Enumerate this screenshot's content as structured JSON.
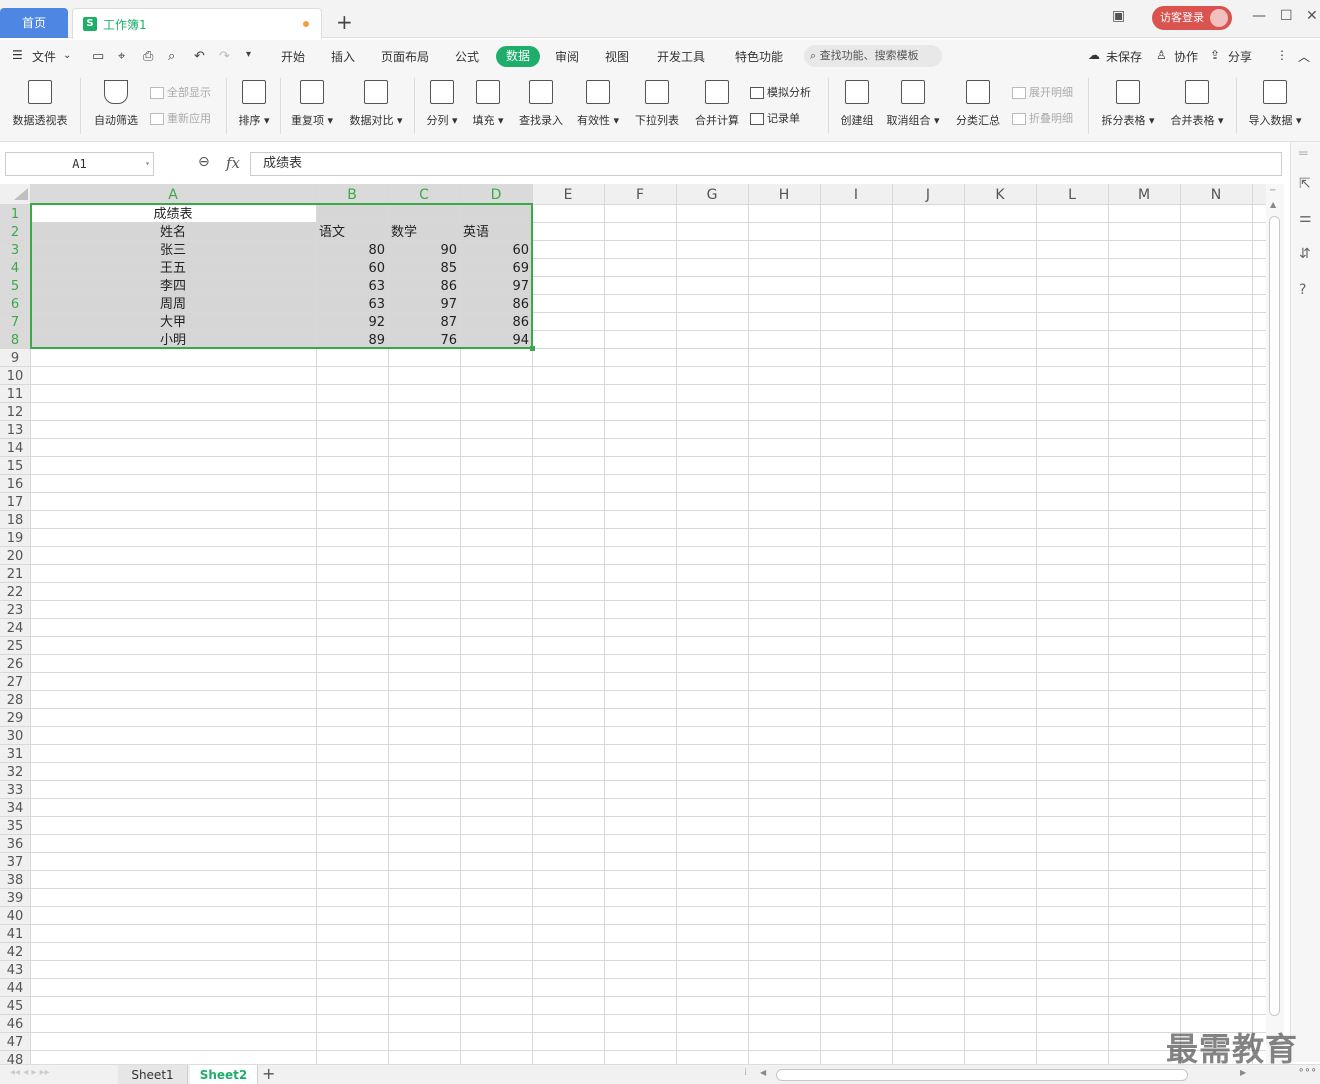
{
  "titlebar": {
    "home_tab": "首页",
    "doc_tab": "工作簿1",
    "sheet_icon_letter": "S",
    "add_tab": "+",
    "login": "访客登录"
  },
  "menubar": {
    "file": "文件",
    "tabs": [
      "开始",
      "插入",
      "页面布局",
      "公式",
      "数据",
      "审阅",
      "视图",
      "开发工具",
      "特色功能"
    ],
    "active_tab": "数据",
    "search": "查找功能、搜索模板",
    "unsaved": "未保存",
    "collab": "协作",
    "share": "分享"
  },
  "ribbon": {
    "pivot": "数据透视表",
    "autofilter": "自动筛选",
    "show_all": "全部显示",
    "reapply": "重新应用",
    "sort": "排序",
    "duplicates": "重复项",
    "compare": "数据对比",
    "split_col": "分列",
    "fill": "填充",
    "lookup": "查找录入",
    "validity": "有效性",
    "dropdown": "下拉列表",
    "consolidate": "合并计算",
    "whatif": "模拟分析",
    "record": "记录单",
    "group": "创建组",
    "ungroup": "取消组合",
    "subtotal": "分类汇总",
    "expand": "展开明细",
    "collapse": "折叠明细",
    "split_table": "拆分表格",
    "merge_table": "合并表格",
    "import": "导入数据"
  },
  "formula": {
    "cell_ref": "A1",
    "fx": "fx",
    "content": "成绩表"
  },
  "sheet": {
    "columns": [
      "A",
      "B",
      "C",
      "D",
      "E",
      "F",
      "G",
      "H",
      "I",
      "J",
      "K",
      "L",
      "M",
      "N"
    ],
    "row_count": 48,
    "title": "成绩表",
    "headers": [
      "姓名",
      "语文",
      "数学",
      "英语"
    ],
    "rows": [
      [
        "张三",
        "80",
        "90",
        "60"
      ],
      [
        "王五",
        "60",
        "85",
        "69"
      ],
      [
        "李四",
        "63",
        "86",
        "97"
      ],
      [
        "周周",
        "63",
        "97",
        "86"
      ],
      [
        "大甲",
        "92",
        "87",
        "86"
      ],
      [
        "小明",
        "89",
        "76",
        "94"
      ]
    ]
  },
  "sheet_tabs": [
    "Sheet1",
    "Sheet2"
  ],
  "active_sheet": "Sheet2",
  "watermark": "最需教育",
  "colors": {
    "accent": "#1fae6a",
    "home_tab": "#4e86e4",
    "selection": "#3ca84a"
  }
}
